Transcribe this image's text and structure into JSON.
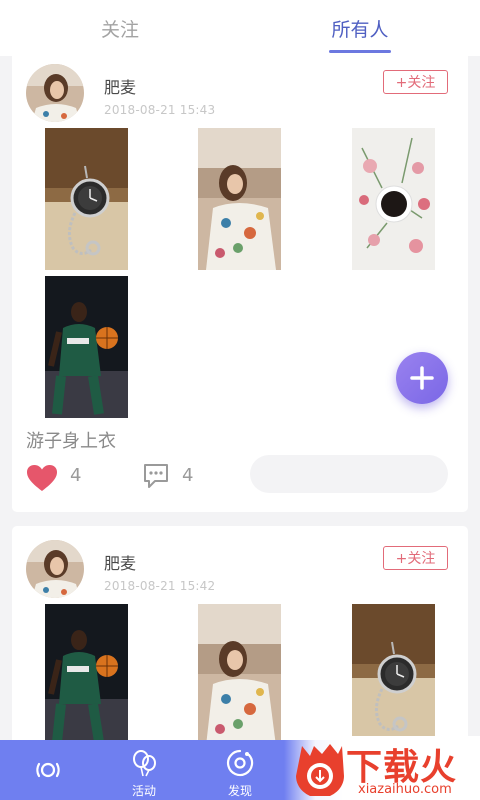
{
  "tabs": [
    {
      "label": "关注",
      "active": false
    },
    {
      "label": "所有人",
      "active": true
    }
  ],
  "posts": [
    {
      "username": "肥麦",
      "time": "2018-08-21 15:43",
      "follow_label": "+关注",
      "photos": [
        "pocket-watch",
        "woman-floral-dress",
        "coffee-flowers",
        "basketball-player"
      ],
      "caption": "游子身上衣",
      "likes": "4",
      "comments": "4",
      "comment_placeholder": ""
    },
    {
      "username": "肥麦",
      "time": "2018-08-21 15:42",
      "follow_label": "+关注",
      "photos": [
        "basketball-player",
        "woman-floral-dress",
        "pocket-watch"
      ]
    }
  ],
  "bottom_nav": [
    {
      "label": "",
      "icon": "signal-ring-icon"
    },
    {
      "label": "活动",
      "icon": "balloons-icon"
    },
    {
      "label": "发现",
      "icon": "compass-icon"
    },
    {
      "label": "",
      "icon": ""
    },
    {
      "label": "",
      "icon": ""
    }
  ],
  "watermark": {
    "title": "下载火",
    "domain": "xiazaihuo.com"
  },
  "colors": {
    "accent": "#6f7ff0",
    "tab_active": "#4f5fc2",
    "follow": "#e26b79",
    "like": "#e6566b",
    "fab": "#8a74ec",
    "watermark": "#e8402d"
  }
}
